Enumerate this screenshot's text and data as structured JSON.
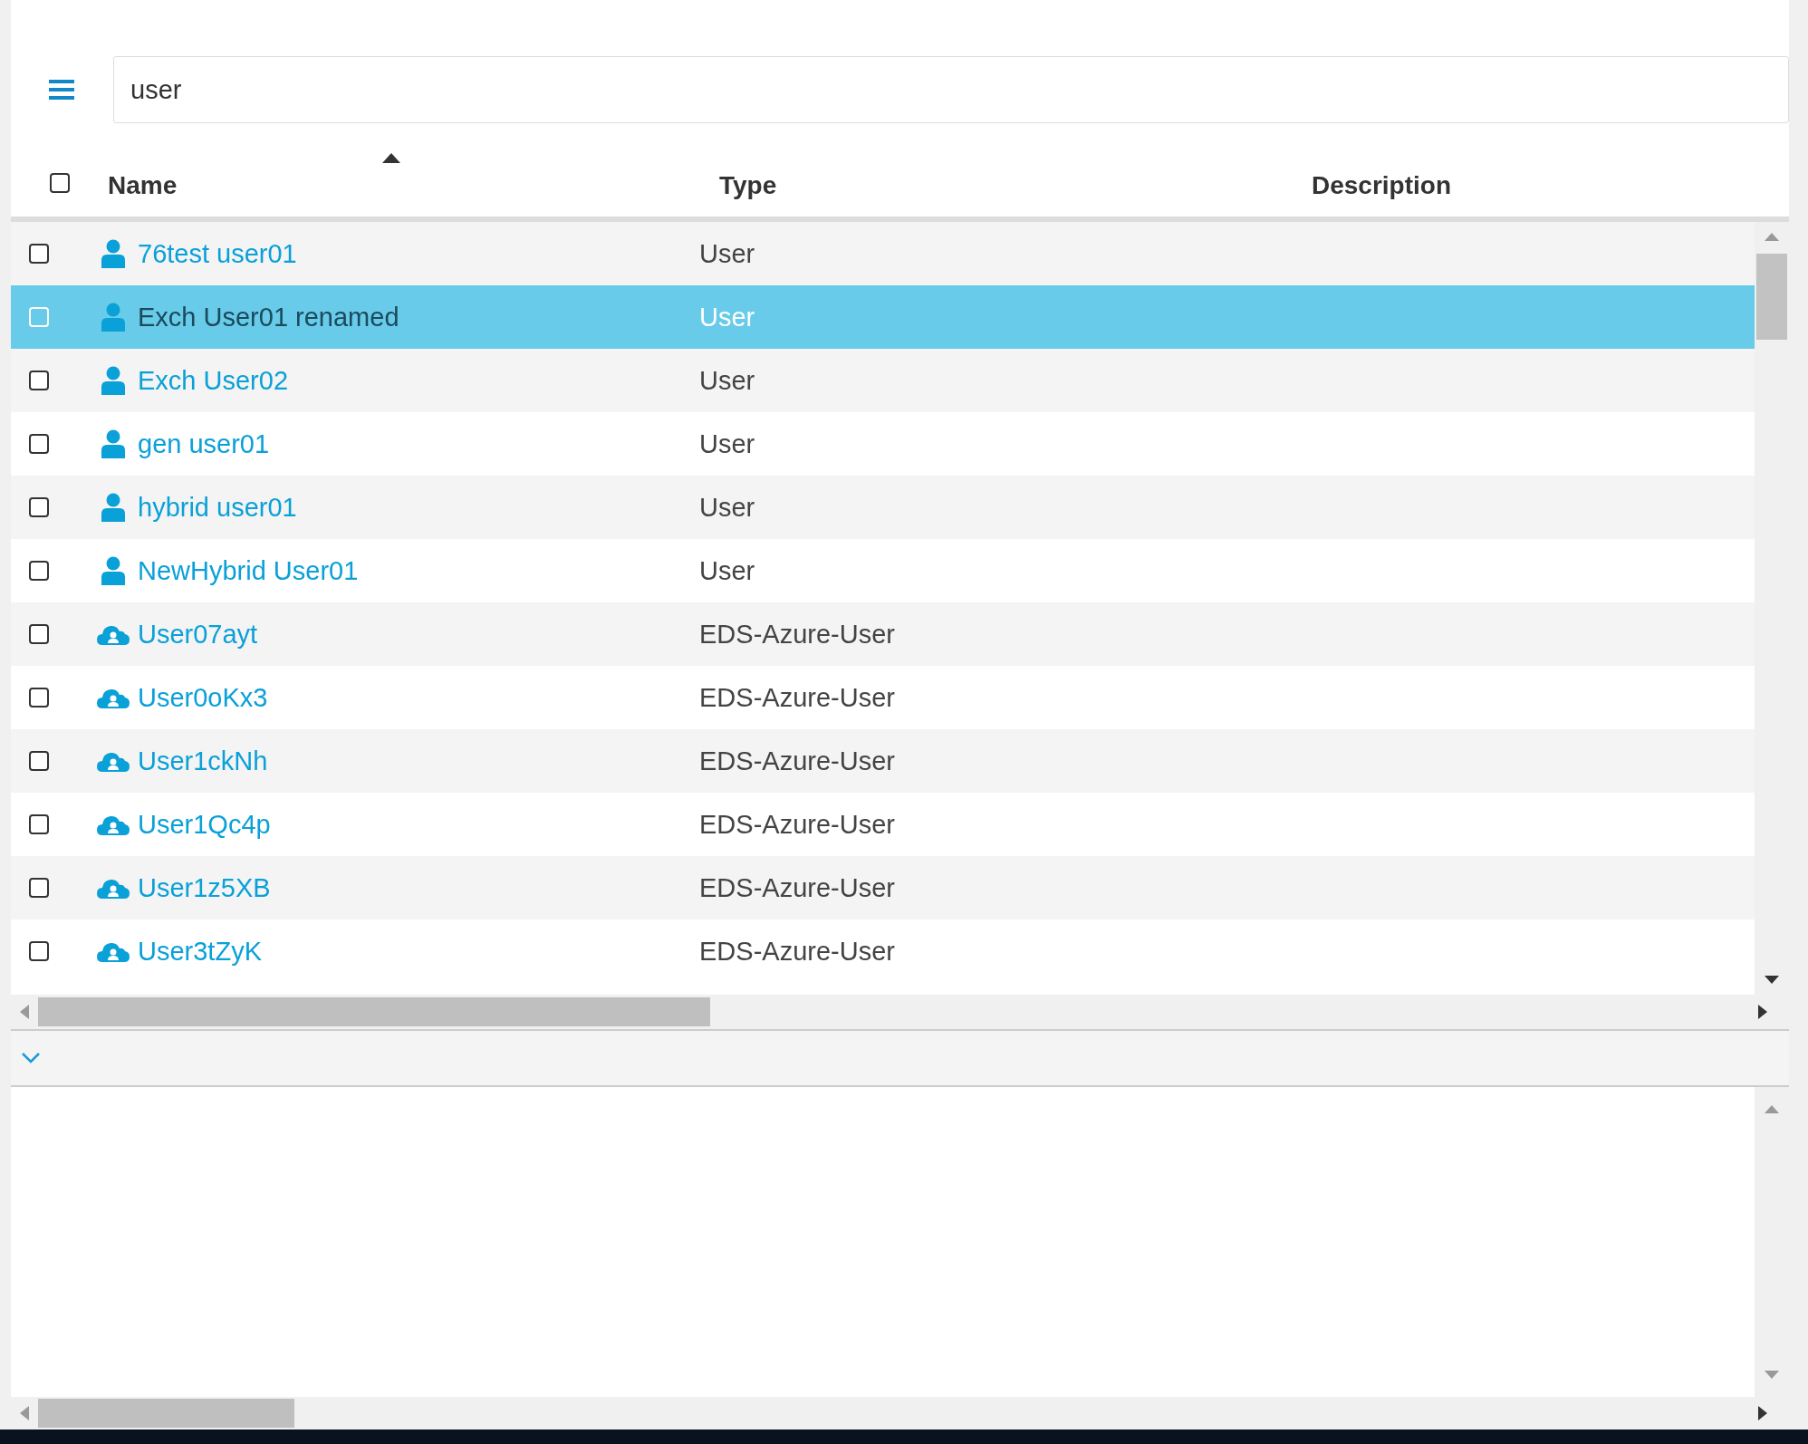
{
  "search": {
    "value": "user"
  },
  "table": {
    "columns": [
      {
        "label": "Name",
        "sorted": true
      },
      {
        "label": "Type",
        "sorted": false
      },
      {
        "label": "Description",
        "sorted": false
      }
    ],
    "select_all_checked": false,
    "rows": [
      {
        "kind": "user",
        "name": "76test user01",
        "type": "User",
        "selected": false,
        "checked": false
      },
      {
        "kind": "user",
        "name": "Exch User01 renamed",
        "type": "User",
        "selected": true,
        "checked": false
      },
      {
        "kind": "user",
        "name": "Exch User02",
        "type": "User",
        "selected": false,
        "checked": false
      },
      {
        "kind": "user",
        "name": "gen user01",
        "type": "User",
        "selected": false,
        "checked": false
      },
      {
        "kind": "user",
        "name": "hybrid user01",
        "type": "User",
        "selected": false,
        "checked": false
      },
      {
        "kind": "user",
        "name": "NewHybrid User01",
        "type": "User",
        "selected": false,
        "checked": false
      },
      {
        "kind": "azure-user",
        "name": "User07ayt",
        "type": "EDS-Azure-User",
        "selected": false,
        "checked": false
      },
      {
        "kind": "azure-user",
        "name": "User0oKx3",
        "type": "EDS-Azure-User",
        "selected": false,
        "checked": false
      },
      {
        "kind": "azure-user",
        "name": "User1ckNh",
        "type": "EDS-Azure-User",
        "selected": false,
        "checked": false
      },
      {
        "kind": "azure-user",
        "name": "User1Qc4p",
        "type": "EDS-Azure-User",
        "selected": false,
        "checked": false
      },
      {
        "kind": "azure-user",
        "name": "User1z5XB",
        "type": "EDS-Azure-User",
        "selected": false,
        "checked": false
      },
      {
        "kind": "azure-user",
        "name": "User3tZyK",
        "type": "EDS-Azure-User",
        "selected": false,
        "checked": false
      }
    ]
  }
}
